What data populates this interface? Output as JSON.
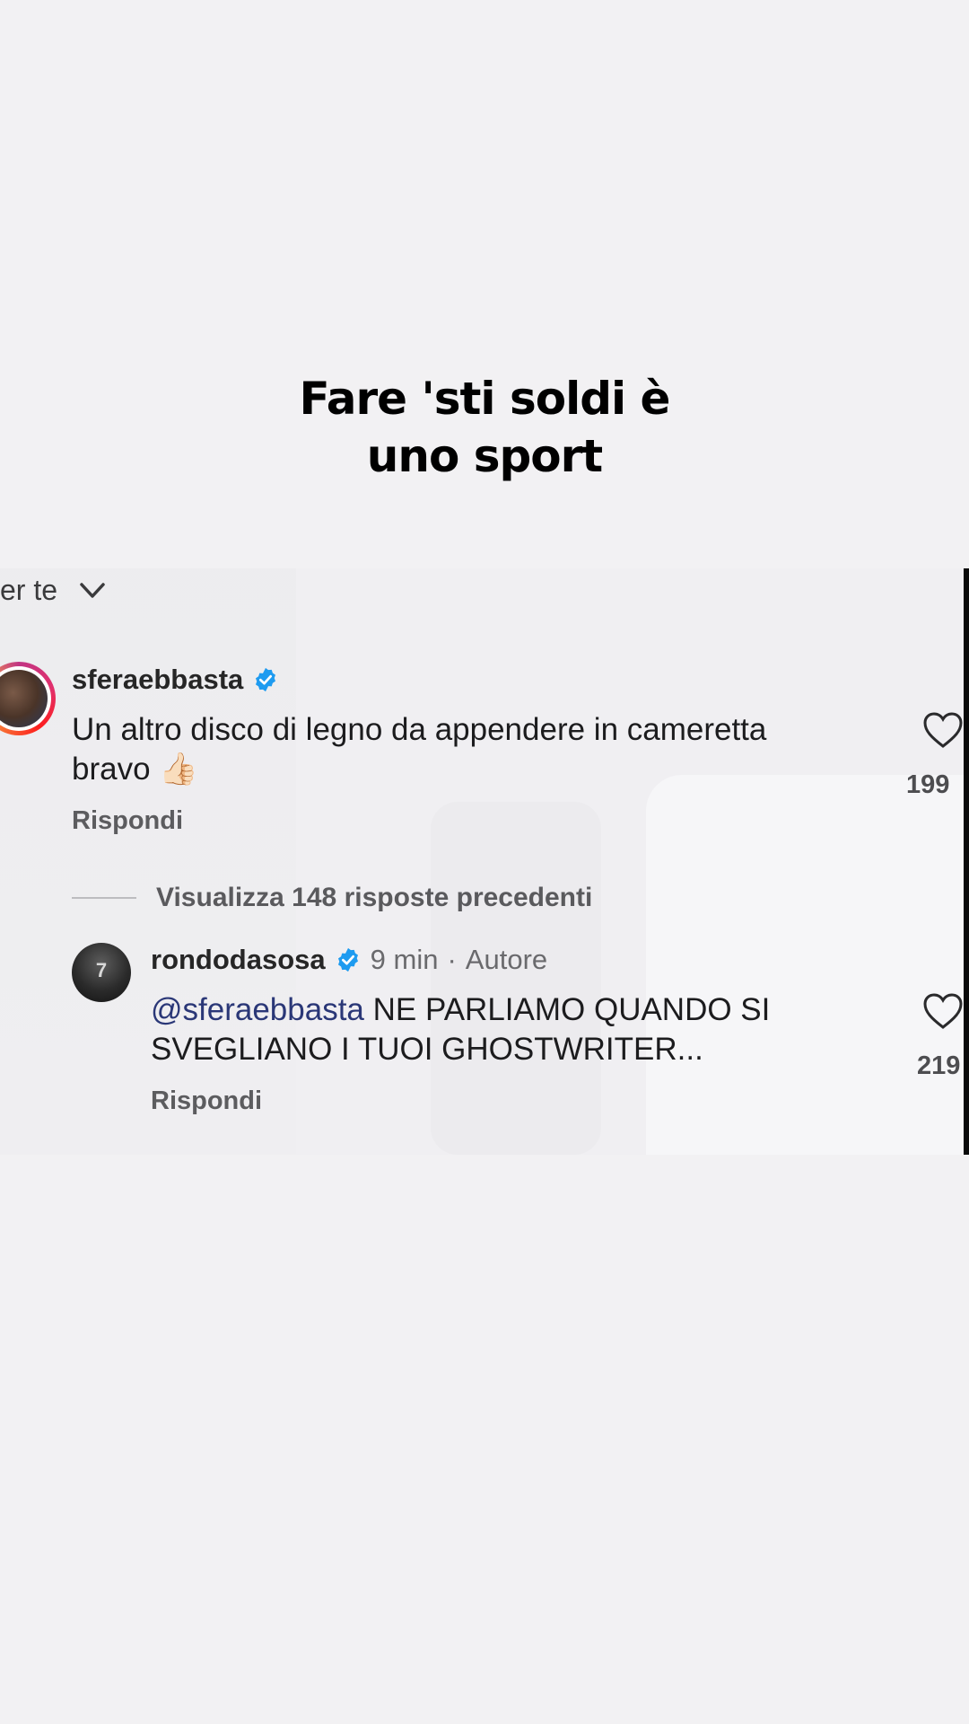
{
  "caption": {
    "line1": "Fare 'sti soldi è",
    "line2": "uno sport"
  },
  "filter": {
    "label": "er te",
    "icon": "chevron-down-icon"
  },
  "comments": [
    {
      "username": "sferaebbasta",
      "verified": true,
      "text_line1": "Un altro disco di legno da appendere in cameretta",
      "text_line2": "bravo 👍🏻",
      "reply_label": "Rispondi",
      "like_count": "199"
    }
  ],
  "view_replies": "Visualizza 148 risposte precedenti",
  "reply": {
    "username": "rondodasosa",
    "verified": true,
    "time": "9 min",
    "separator": "·",
    "author_label": "Autore",
    "mention": "@sferaebbasta",
    "text_line1_rest": " NE PARLIAMO QUANDO SI",
    "text_line2": "SVEGLIANO I TUOI GHOSTWRITER...",
    "reply_label": "Rispondi",
    "like_count": "219",
    "avatar_number": "7"
  },
  "colors": {
    "verified": "#1e9bf0",
    "mention": "#2a3777",
    "background": "#f2f1f3"
  }
}
